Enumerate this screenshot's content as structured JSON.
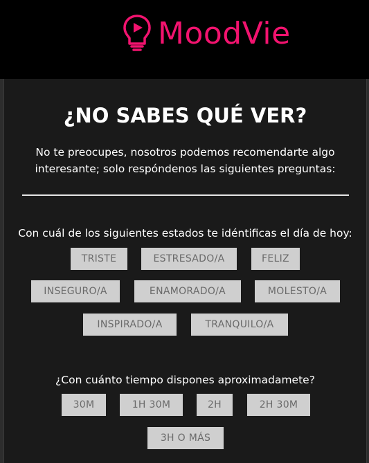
{
  "brand": {
    "name": "MoodVie",
    "color": "#f2136f",
    "logo_icon": "lightbulb-play-icon"
  },
  "title": "¿NO SABES QUÉ VER?",
  "subtitle": "No te preocupes, nosotros podemos recomendarte algo interesante; solo respóndenos las siguientes preguntas:",
  "mood_question": {
    "label": "Con cuál de los siguientes estados te idéntificas el día de hoy:",
    "options": [
      "TRISTE",
      "ESTRESADO/A",
      "FELIZ",
      "INSEGURO/A",
      "ENAMORADO/A",
      "MOLESTO/A",
      "INSPIRADO/A",
      "TRANQUILO/A"
    ]
  },
  "time_question": {
    "label": "¿Con cuánto tiempo dispones aproximadamete?",
    "options": [
      "30M",
      "1H 30M",
      "2H",
      "2H 30M",
      "3H O MÁS"
    ]
  }
}
